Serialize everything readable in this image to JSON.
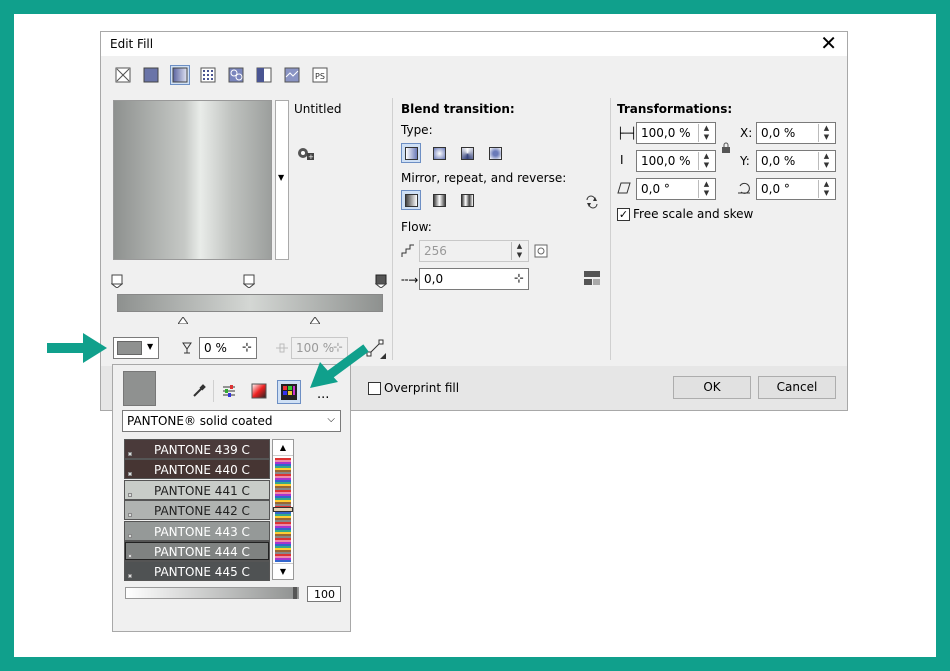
{
  "dialog": {
    "title": "Edit Fill",
    "close_label": "✕",
    "fill_name": "Untitled",
    "blend": {
      "heading": "Blend transition:",
      "type_label": "Type:",
      "mirror_label": "Mirror, repeat, and reverse:",
      "flow_label": "Flow:",
      "flow_steps": "256",
      "flow_accel": "0,0"
    },
    "transform": {
      "heading": "Transformations:",
      "width": "100,0 %",
      "height": "100,0 %",
      "skew": "0,0 °",
      "x_label": "X:",
      "x": "0,0 %",
      "y_label": "Y:",
      "y": "0,0 %",
      "rotate": "0,0 °",
      "free_scale_label": "Free scale and skew",
      "free_scale_checked": true
    },
    "node": {
      "transparency": "0 %",
      "position": "100 %"
    },
    "overprint_label": "Overprint fill",
    "ok_label": "OK",
    "cancel_label": "Cancel"
  },
  "popup": {
    "palette_name": "PANTONE® solid coated",
    "more_label": "...",
    "swatches": [
      {
        "name": "PANTONE 439 C",
        "color": "#4a3a3a",
        "text": "#ffffff"
      },
      {
        "name": "PANTONE 440 C",
        "color": "#463533",
        "text": "#ffffff"
      },
      {
        "name": "PANTONE 441 C",
        "color": "#c8ccc8",
        "text": "#222222"
      },
      {
        "name": "PANTONE 442 C",
        "color": "#b0b3b1",
        "text": "#222222"
      },
      {
        "name": "PANTONE 443 C",
        "color": "#959998",
        "text": "#ffffff"
      },
      {
        "name": "PANTONE 444 C",
        "color": "#7f8281",
        "text": "#ffffff"
      },
      {
        "name": "PANTONE 445 C",
        "color": "#4f5253",
        "text": "#ffffff"
      }
    ],
    "tint": "100"
  },
  "colors": {
    "frame": "#10a08c",
    "arrow": "#10a08c",
    "gradient_dark": "#8e918f",
    "gradient_light": "#e9ece9",
    "selected_node_color": "#8f9190"
  }
}
